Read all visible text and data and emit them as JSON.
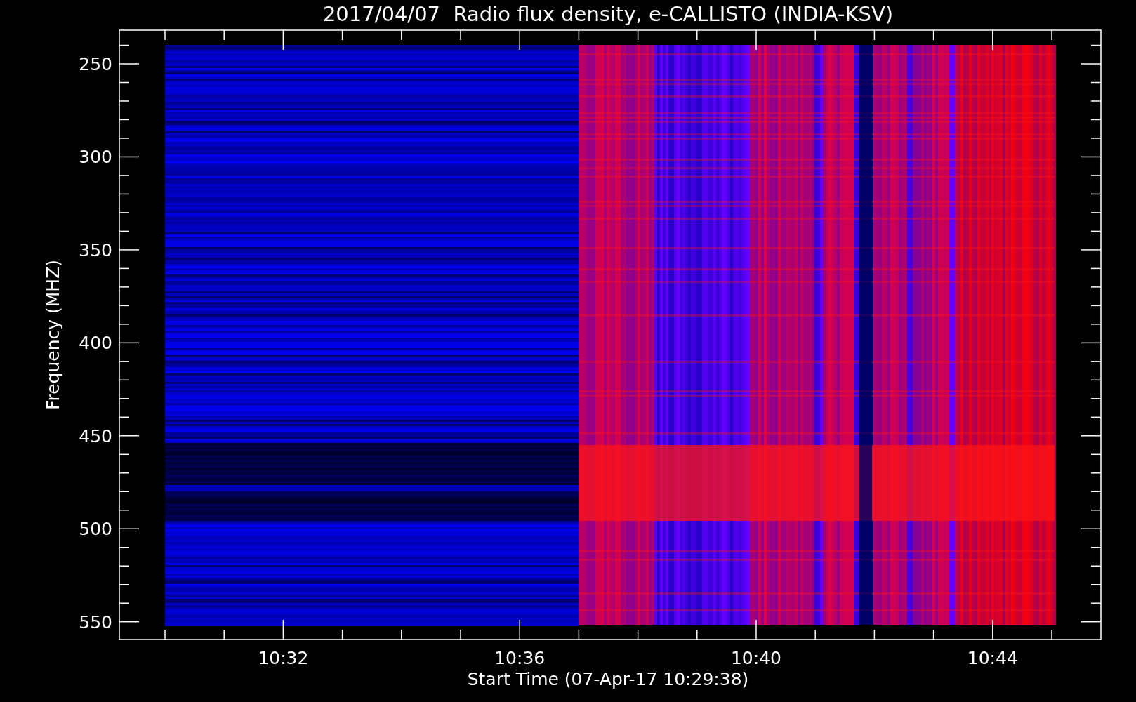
{
  "plot": {
    "title": "2017/04/07  Radio flux density, e-CALLISTO (INDIA-KSV)",
    "ylabel": "Frequency (MHZ)",
    "xlabel": "Start Time (07-Apr-17 10:29:38)",
    "y_ticks": [
      "250",
      "300",
      "350",
      "400",
      "450",
      "500",
      "550"
    ],
    "x_ticks": [
      "10:32",
      "10:36",
      "10:40",
      "10:44"
    ]
  }
}
